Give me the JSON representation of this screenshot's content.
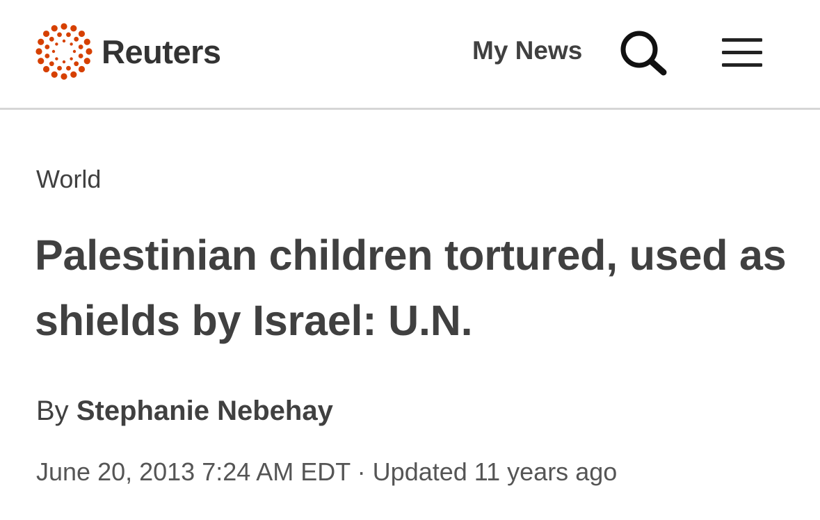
{
  "header": {
    "brand_name": "Reuters",
    "logo_icon": "reuters-dot-ring-logo",
    "my_news_label": "My News",
    "search_icon": "search-icon",
    "menu_icon": "hamburger-menu-icon",
    "brand_color": "#d64000",
    "divider_color": "#d6d6d6"
  },
  "article": {
    "section": "World",
    "headline": "Palestinian children tortured, used as shields by Israel: U.N.",
    "byline_prefix": "By",
    "author": "Stephanie Nebehay",
    "published": "June 20, 2013 7:24 AM EDT",
    "separator": "·",
    "updated": "Updated 11 years ago"
  },
  "colors": {
    "text": "#404040",
    "background": "#ffffff"
  }
}
